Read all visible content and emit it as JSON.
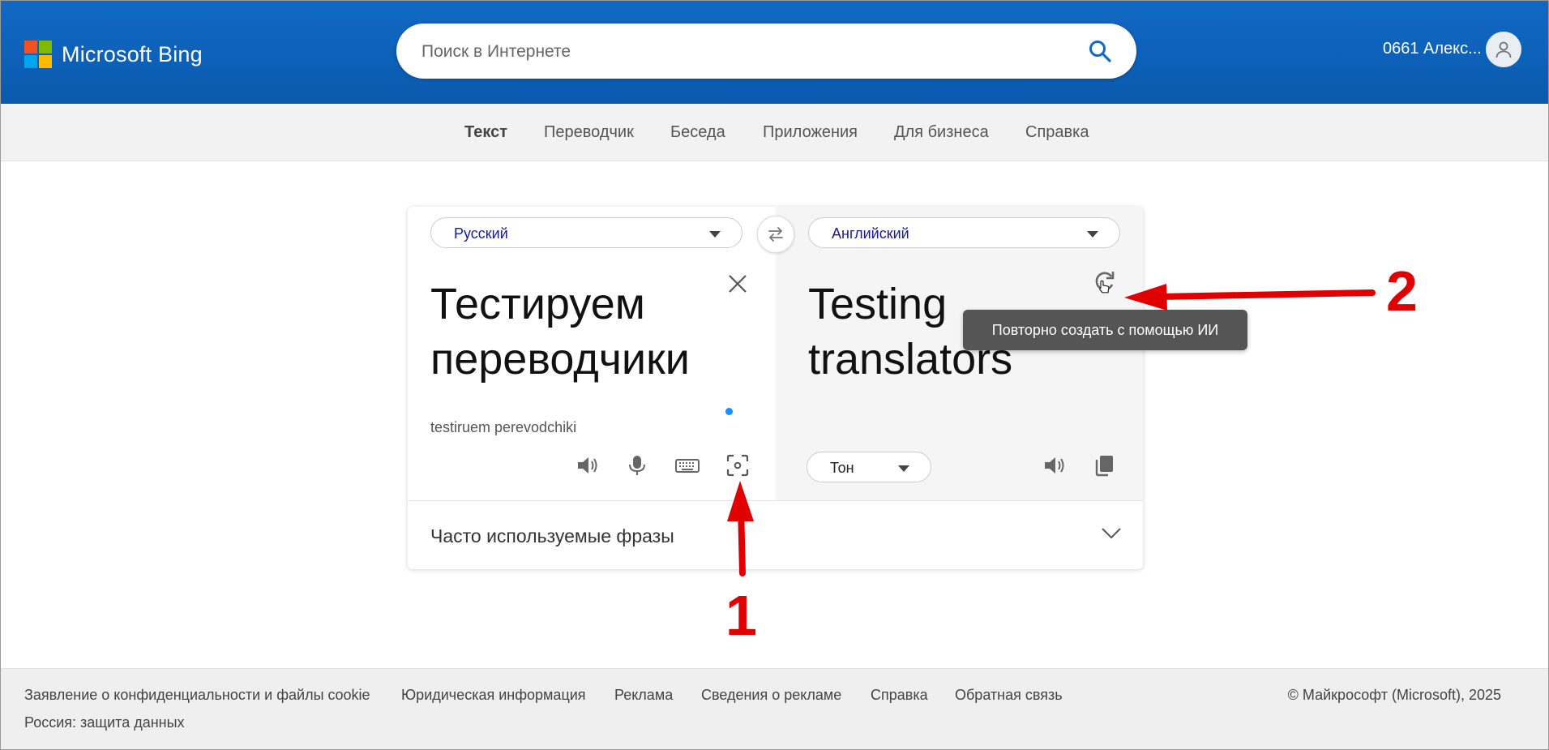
{
  "header": {
    "brand": "Microsoft Bing",
    "search_placeholder": "Поиск в Интернете",
    "user_name": "0661 Алекс..."
  },
  "brand_colors": {
    "red": "#f25022",
    "green": "#7fba00",
    "blue": "#00a4ef",
    "yellow": "#ffb900",
    "header_blue": "#0f66c0"
  },
  "nav": {
    "items": [
      {
        "label": "Текст",
        "active": true
      },
      {
        "label": "Переводчик"
      },
      {
        "label": "Беседа"
      },
      {
        "label": "Приложения"
      },
      {
        "label": "Для бизнеса"
      },
      {
        "label": "Справка"
      }
    ]
  },
  "translator": {
    "source_lang": "Русский",
    "target_lang": "Английский",
    "source_text_line1": "Тестируем",
    "source_text_line2": "переводчики",
    "transliteration": "testiruem perevodchiki",
    "target_text_line1": "Testing",
    "target_text_line2": "translators",
    "tone_label": "Тон",
    "phrases_label": "Часто используемые фразы",
    "tooltip": "Повторно создать с помощью ИИ",
    "source_icons": [
      "speaker-icon",
      "microphone-icon",
      "keyboard-icon",
      "camera-scan-icon"
    ],
    "target_icons": [
      "speaker-icon",
      "copy-icon",
      "refresh-icon"
    ]
  },
  "annotations": {
    "marker_1": "1",
    "marker_2": "2",
    "color": "#e00000"
  },
  "footer": {
    "links": [
      "Заявление о конфиденциальности и файлы cookie",
      "Юридическая информация",
      "Реклама",
      "Сведения о рекламе",
      "Справка",
      "Обратная связь"
    ],
    "copyright": "© Майкрософт (Microsoft), 2025",
    "sub_link": "Россия: защита данных"
  }
}
